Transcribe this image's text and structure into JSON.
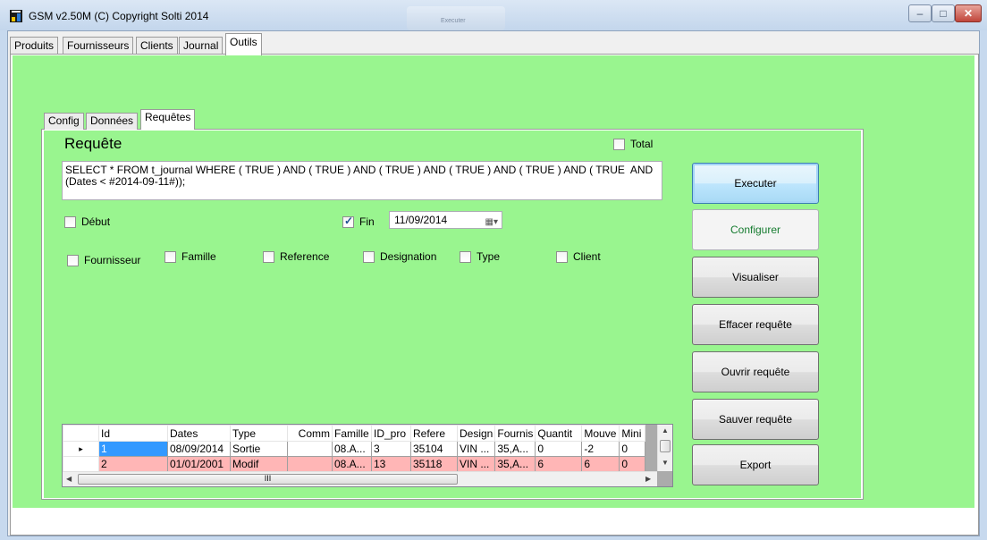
{
  "window": {
    "title": "GSM v2.50M (C) Copyright Solti 2014",
    "ghost_label": "Executer"
  },
  "main_tabs": [
    {
      "label": "Produits"
    },
    {
      "label": "Fournisseurs"
    },
    {
      "label": "Clients"
    },
    {
      "label": "Journal"
    },
    {
      "label": "Outils"
    }
  ],
  "sub_tabs": [
    {
      "label": "Config"
    },
    {
      "label": "Données"
    },
    {
      "label": "Requêtes"
    }
  ],
  "query": {
    "title": "Requête",
    "total_label": "Total",
    "sql": "SELECT * FROM t_journal WHERE ( TRUE ) AND ( TRUE ) AND ( TRUE ) AND ( TRUE ) AND ( TRUE ) AND ( TRUE  AND\n(Dates < #2014-09-11#));",
    "debut_label": "Début",
    "fin_label": "Fin",
    "fin_checked": true,
    "date_value": "11/09/2014",
    "filters": [
      "Fournisseur",
      "Famille",
      "Reference",
      "Designation",
      "Type",
      "Client"
    ]
  },
  "buttons": {
    "executer": "Executer",
    "configurer": "Configurer",
    "visualiser": "Visualiser",
    "effacer": "Effacer requête",
    "ouvrir": "Ouvrir requête",
    "sauver": "Sauver requête",
    "export": "Export"
  },
  "grid": {
    "columns": [
      "Id",
      "Dates",
      "Type",
      "Comm",
      "Famille",
      "ID_pro",
      "Refere",
      "Design",
      "Fournis",
      "Quantit",
      "Mouve",
      "Mini"
    ],
    "rows": [
      [
        "1",
        "08/09/2014",
        "Sortie",
        "",
        "08.A...",
        "3",
        "35104",
        "VIN ...",
        "35,A...",
        "0",
        "-2",
        "0"
      ],
      [
        "2",
        "01/01/2001",
        "Modif",
        "",
        "08.A...",
        "13",
        "35118",
        "VIN ...",
        "35,A...",
        "6",
        "6",
        "0"
      ]
    ],
    "row_marker": "▸",
    "scroll_grip": "III"
  },
  "colors": {
    "panel_green": "#99f58f",
    "row_highlight": "#ffb6b6",
    "selection": "#3399ff"
  }
}
